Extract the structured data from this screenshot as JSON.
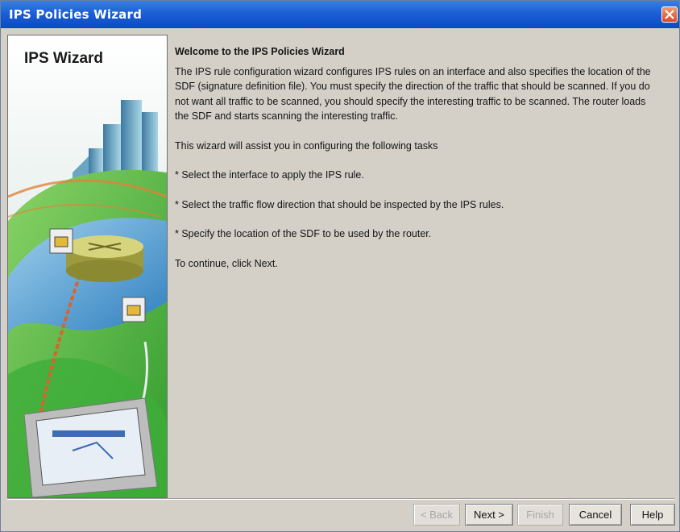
{
  "window": {
    "title": "IPS Policies Wizard"
  },
  "sidebar": {
    "title": "IPS Wizard"
  },
  "content": {
    "heading": "Welcome to the IPS Policies Wizard",
    "intro": "The IPS rule configuration wizard configures IPS rules on an interface and also specifies the location of the SDF (signature definition file). You must specify the direction of the traffic that should be scanned. If you do not want all traffic to be scanned, you should specify the interesting traffic to be scanned. The router loads the SDF and starts scanning the interesting traffic.",
    "tasks_intro": "This wizard will assist you in configuring the following tasks",
    "task_1": "* Select the interface to apply the IPS rule.",
    "task_2": "* Select the traffic flow direction that should be inspected by the IPS rules.",
    "task_3": "* Specify the location of the SDF to be used by the router.",
    "continue_text": "To continue, click Next."
  },
  "buttons": {
    "back": "< Back",
    "next": "Next >",
    "finish": "Finish",
    "cancel": "Cancel",
    "help": "Help"
  }
}
